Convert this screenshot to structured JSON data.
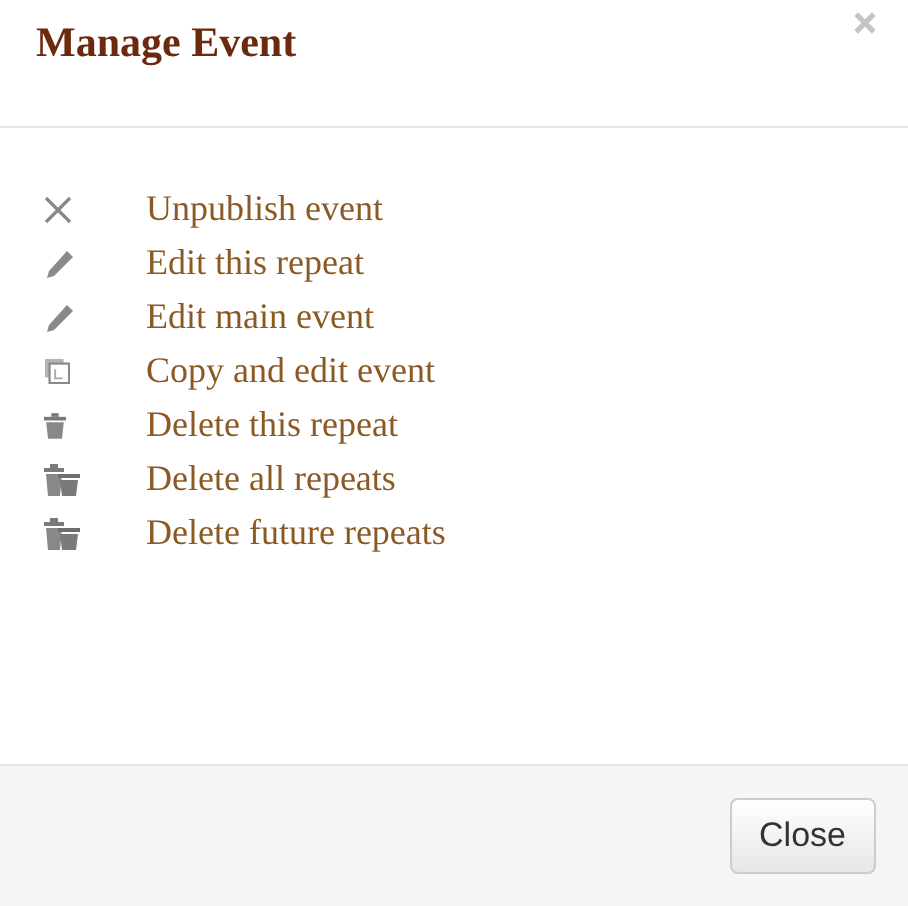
{
  "dialog": {
    "title": "Manage Event"
  },
  "actions": [
    {
      "kind": "unpublish",
      "label": "Unpublish event"
    },
    {
      "kind": "edit",
      "label": "Edit this repeat"
    },
    {
      "kind": "edit",
      "label": "Edit main event"
    },
    {
      "kind": "copy",
      "label": "Copy and edit event"
    },
    {
      "kind": "delete",
      "label": "Delete this repeat"
    },
    {
      "kind": "delete-multiple",
      "label": "Delete all repeats"
    },
    {
      "kind": "delete-multiple",
      "label": "Delete future repeats"
    }
  ],
  "buttons": [
    "Close"
  ]
}
